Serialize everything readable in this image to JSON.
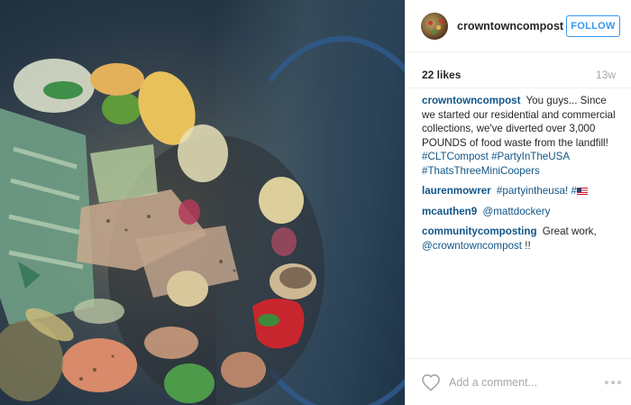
{
  "post": {
    "photo_icon": "photo-icon"
  },
  "header": {
    "username": "crowntowncompost",
    "follow_label": "FOLLOW",
    "follow_color": "#3897f0"
  },
  "stats": {
    "likes": "22 likes",
    "age": "13w"
  },
  "comments": [
    {
      "user": "crowntowncompost",
      "text": "You guys... Since we started our residential and commercial collections, we've diverted over 3,000 POUNDS of food waste from the landfill!",
      "tags": "#CLTCompost #PartyInTheUSA #ThatsThreeMiniCoopers"
    },
    {
      "user": "laurenmowrer",
      "tag": "#partyintheusa!",
      "tag2": "#",
      "flag_icon": "us-flag-icon"
    },
    {
      "user": "mcauthen9",
      "mention": "@mattdockery"
    },
    {
      "user": "communitycomposting",
      "text": "Great work,",
      "mention": "@crowntowncompost",
      "suffix": "!!"
    }
  ],
  "footer": {
    "heart_icon": "heart-icon",
    "comment_placeholder": "Add a comment...",
    "more_icon": "more-icon"
  },
  "colors": {
    "link": "#125688",
    "muted": "#a5a7aa",
    "divider": "#efefef"
  }
}
